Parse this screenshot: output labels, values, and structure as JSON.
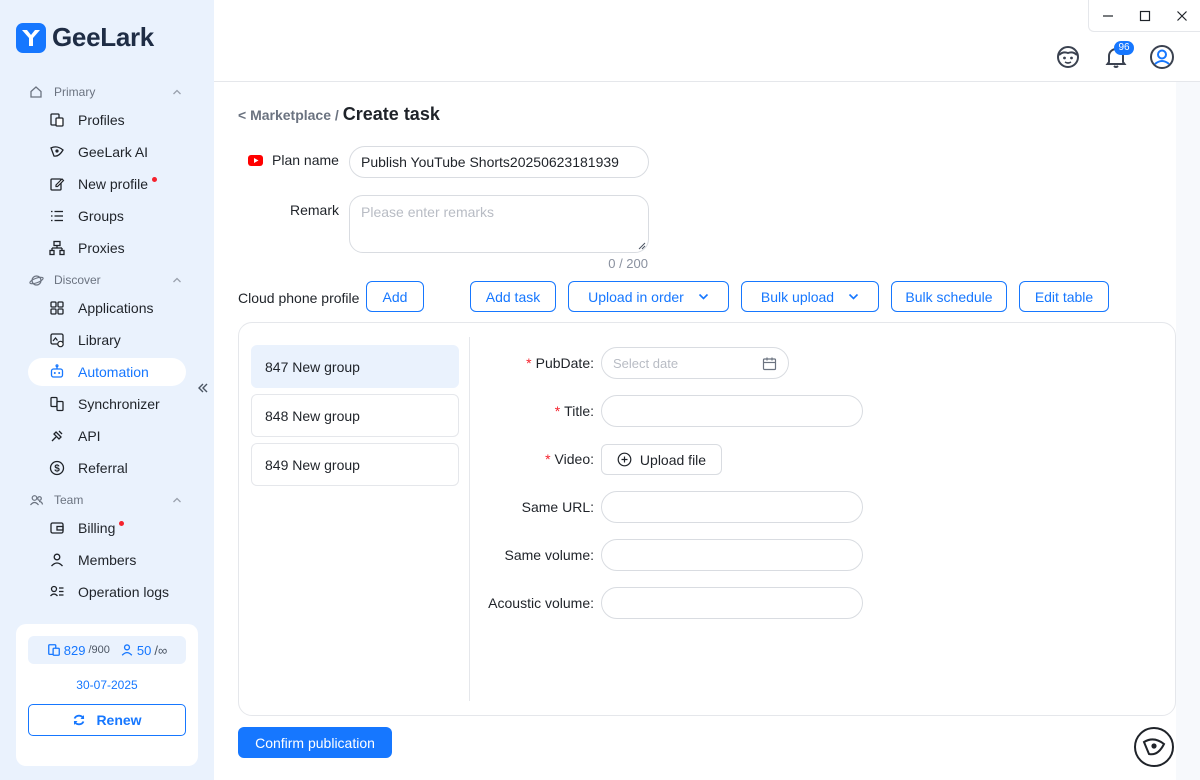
{
  "app": {
    "name": "GeeLark"
  },
  "sidebar": {
    "sections": [
      {
        "label": "Primary",
        "icon": "home-icon"
      },
      {
        "label": "Discover",
        "icon": "planet-icon"
      },
      {
        "label": "Team",
        "icon": "team-icon"
      }
    ],
    "items": [
      {
        "label": "Profiles",
        "icon": "profiles-icon"
      },
      {
        "label": "GeeLark AI",
        "icon": "ai-icon"
      },
      {
        "label": "New profile",
        "icon": "edit-icon",
        "dot": true
      },
      {
        "label": "Groups",
        "icon": "list-icon"
      },
      {
        "label": "Proxies",
        "icon": "proxy-icon"
      },
      {
        "label": "Applications",
        "icon": "apps-icon"
      },
      {
        "label": "Library",
        "icon": "library-icon"
      },
      {
        "label": "Automation",
        "icon": "robot-icon",
        "active": true
      },
      {
        "label": "Synchronizer",
        "icon": "sync-icon"
      },
      {
        "label": "API",
        "icon": "api-icon"
      },
      {
        "label": "Referral",
        "icon": "dollar-icon"
      },
      {
        "label": "Billing",
        "icon": "wallet-icon",
        "dot": true
      },
      {
        "label": "Members",
        "icon": "user-icon"
      },
      {
        "label": "Operation logs",
        "icon": "logs-icon"
      }
    ],
    "quota": {
      "profiles_used": "829",
      "profiles_total": "/900",
      "members_used": "50",
      "members_total": "/∞",
      "expiry": "30-07-2025",
      "renew_label": "Renew"
    }
  },
  "header": {
    "notification_count": "96"
  },
  "breadcrumb": {
    "back": "< Marketplace /",
    "current": "Create task"
  },
  "form": {
    "plan_name_label": "Plan name",
    "plan_name_value": "Publish YouTube Shorts20250623181939",
    "remark_label": "Remark",
    "remark_placeholder": "Please enter remarks",
    "remark_counter": "0 / 200",
    "cloud_phone_label": "Cloud phone profile",
    "add_label": "Add",
    "toolbar": {
      "add_task": "Add task",
      "upload_in_order": "Upload in order",
      "bulk_upload": "Bulk upload",
      "bulk_schedule": "Bulk schedule",
      "edit_table": "Edit table"
    }
  },
  "groups": [
    "847 New group",
    "848 New group",
    "849 New group"
  ],
  "task_fields": {
    "pubdate_label": "PubDate",
    "pubdate_placeholder": "Select date",
    "title_label": "Title",
    "video_label": "Video",
    "upload_label": "Upload file",
    "same_url_label": "Same URL",
    "same_volume_label": "Same volume",
    "acoustic_volume_label": "Acoustic volume"
  },
  "confirm_label": "Confirm publication",
  "colors": {
    "accent": "#1677ff",
    "required": "#f5222d",
    "youtube": "#ff0000",
    "sidebar_bg": "#eaf2fd"
  }
}
